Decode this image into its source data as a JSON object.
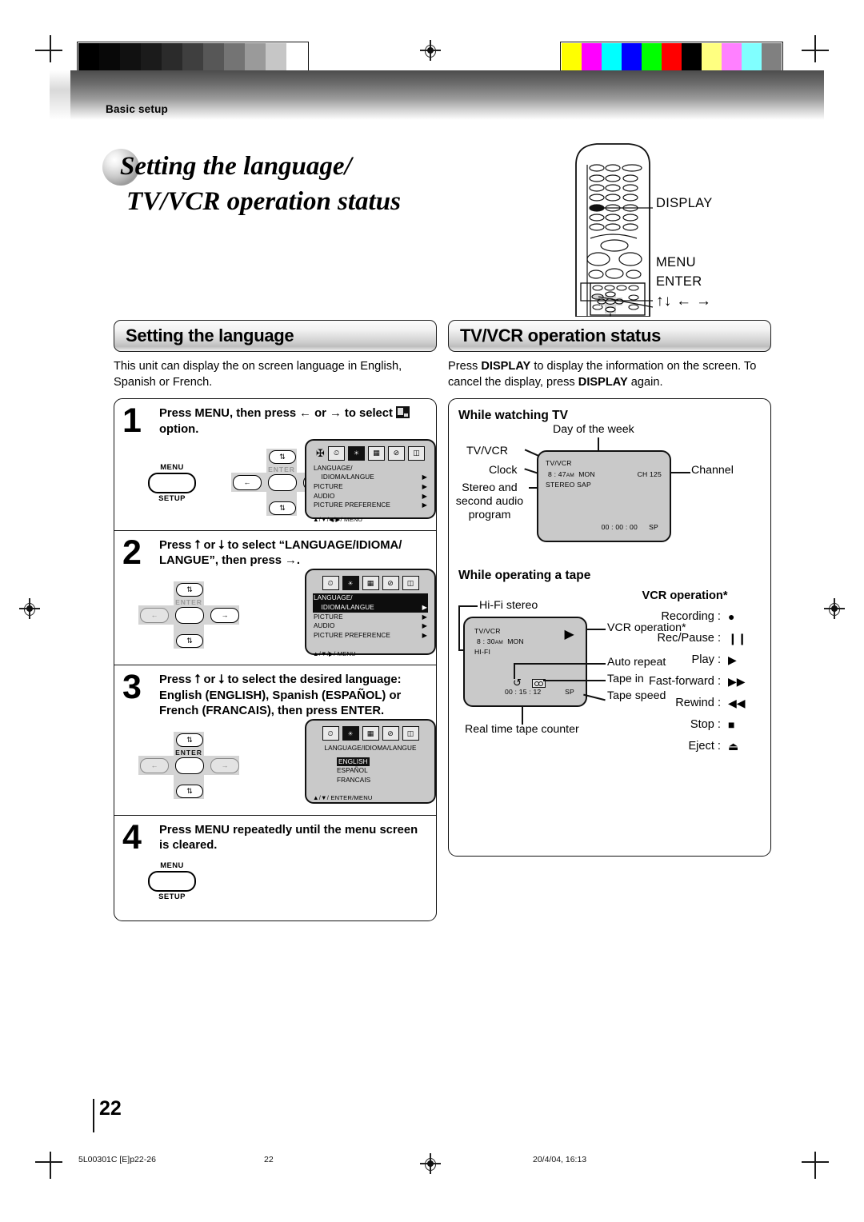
{
  "header": {
    "breadcrumb": "Basic setup"
  },
  "title": {
    "line1": "Setting the language/",
    "line2": "TV/VCR operation status"
  },
  "remote": {
    "labels": [
      {
        "name": "display",
        "text": "DISPLAY"
      },
      {
        "name": "menu",
        "text": "MENU"
      },
      {
        "name": "enter",
        "text": "ENTER"
      },
      {
        "name": "arrows",
        "text": "↑↓ ← →"
      }
    ]
  },
  "left": {
    "heading": "Setting the language",
    "intro": "This unit can display the on screen language in English, Spanish or French.",
    "steps": [
      {
        "number": "1",
        "text_a": "Press MENU, then press ",
        "arrow_left": "←",
        "text_or": " or ",
        "arrow_right": "→",
        "text_b": " to select ",
        "text_c": " option.",
        "menu_button": {
          "top": "MENU",
          "bottom": "SETUP"
        },
        "osd": {
          "rows": [
            {
              "label": "LANGUAGE/",
              "arrow": "",
              "highlight": false
            },
            {
              "label": "    IDIOMA/LANGUE",
              "arrow": "▶",
              "highlight": false
            },
            {
              "label": "PICTURE",
              "arrow": "▶",
              "highlight": false
            },
            {
              "label": "AUDIO",
              "arrow": "▶",
              "highlight": false
            },
            {
              "label": "PICTURE  PREFERENCE",
              "arrow": "▶",
              "highlight": false
            }
          ],
          "nav": "▲/▼/◀/▶/ MENU"
        }
      },
      {
        "number": "2",
        "text": "Press ⭡ or ⭣ to select “LANGUAGE/IDIOMA/ LANGUE”, then press →.",
        "osd": {
          "rows": [
            {
              "label": "LANGUAGE/",
              "arrow": "",
              "highlight": true
            },
            {
              "label": "    IDIOMA/LANGUE",
              "arrow": "▶",
              "highlight": true
            },
            {
              "label": "PICTURE",
              "arrow": "▶",
              "highlight": false
            },
            {
              "label": "AUDIO",
              "arrow": "▶",
              "highlight": false
            },
            {
              "label": "PICTURE  PREFERENCE",
              "arrow": "▶",
              "highlight": false
            }
          ],
          "nav": "▲/▼/▶/ MENU"
        }
      },
      {
        "number": "3",
        "text": "Press ⭡ or ⭣ to select the desired language: English (ENGLISH), Spanish (ESPAÑOL) or French (FRANCAIS), then press ENTER.",
        "osd": {
          "title": "LANGUAGE/IDIOMA/LANGUE",
          "options": [
            "ENGLISH",
            "ESPAÑOL",
            "FRANCAIS"
          ],
          "selected": "ENGLISH",
          "nav": "▲/▼/ ENTER/MENU"
        }
      },
      {
        "number": "4",
        "text": "Press MENU repeatedly until the menu screen is cleared.",
        "menu_button": {
          "top": "MENU",
          "bottom": "SETUP"
        }
      }
    ]
  },
  "right": {
    "heading": "TV/VCR operation status",
    "intro_a": "Press ",
    "intro_display": "DISPLAY",
    "intro_b": " to display the information on the screen. To cancel the display, press ",
    "intro_c": " again.",
    "watching_tv": {
      "heading": "While watching TV",
      "callouts": {
        "day_of_week": "Day of the week",
        "tv_vcr": "TV/VCR",
        "clock": "Clock",
        "stereo": "Stereo and second audio program",
        "channel": "Channel"
      },
      "screen": {
        "tvvcr": "TV/VCR",
        "clock": "8 : 47",
        "clock_ampm": "AM",
        "day": "MON",
        "audio": "STEREO  SAP",
        "channel_label": "CH",
        "channel_num": "125",
        "counter": "00 : 00 : 00",
        "speed": "SP"
      }
    },
    "operating_tape": {
      "heading": "While operating a tape",
      "callouts": {
        "hifi": "Hi-Fi stereo",
        "vcr_operation": "VCR operation*",
        "auto_repeat": "Auto repeat",
        "tape_in": "Tape in",
        "tape_speed": "Tape speed",
        "counter": "Real time tape counter"
      },
      "screen": {
        "tvvcr": "TV/VCR",
        "clock": "8 : 30",
        "clock_ampm": "AM",
        "day": "MON",
        "hifi": "HI-FI",
        "play_glyph": "▶",
        "repeat_glyph": "↺",
        "counter": "00 : 15 : 12",
        "speed": "SP"
      },
      "vcr_operation": {
        "heading": "VCR operation*",
        "items": [
          {
            "label": "Recording :",
            "glyph": "●"
          },
          {
            "label": "Rec/Pause :",
            "glyph": "❙❙"
          },
          {
            "label": "Play :",
            "glyph": "▶"
          },
          {
            "label": "Fast-forward :",
            "glyph": "▶▶"
          },
          {
            "label": "Rewind :",
            "glyph": "◀◀"
          },
          {
            "label": "Stop :",
            "glyph": "■"
          },
          {
            "label": "Eject :",
            "glyph": "⏏"
          }
        ]
      }
    }
  },
  "footer": {
    "page_number": "22",
    "file_ref": "5L00301C [E]p22-26",
    "center_page": "22",
    "timestamp": "20/4/04, 16:13"
  },
  "colors": {
    "grayscale": [
      "#000000",
      "#080808",
      "#111111",
      "#1b1b1b",
      "#2b2b2b",
      "#3f3f3f",
      "#575757",
      "#747474",
      "#9a9a9a",
      "#c6c6c6",
      "#ffffff"
    ],
    "colorbars": [
      "#ffff00",
      "#ff00ff",
      "#00ffff",
      "#0000ff",
      "#00ff00",
      "#ff0000",
      "#000000",
      "#ffff80",
      "#ff80ff",
      "#80ffff",
      "#808080"
    ]
  }
}
